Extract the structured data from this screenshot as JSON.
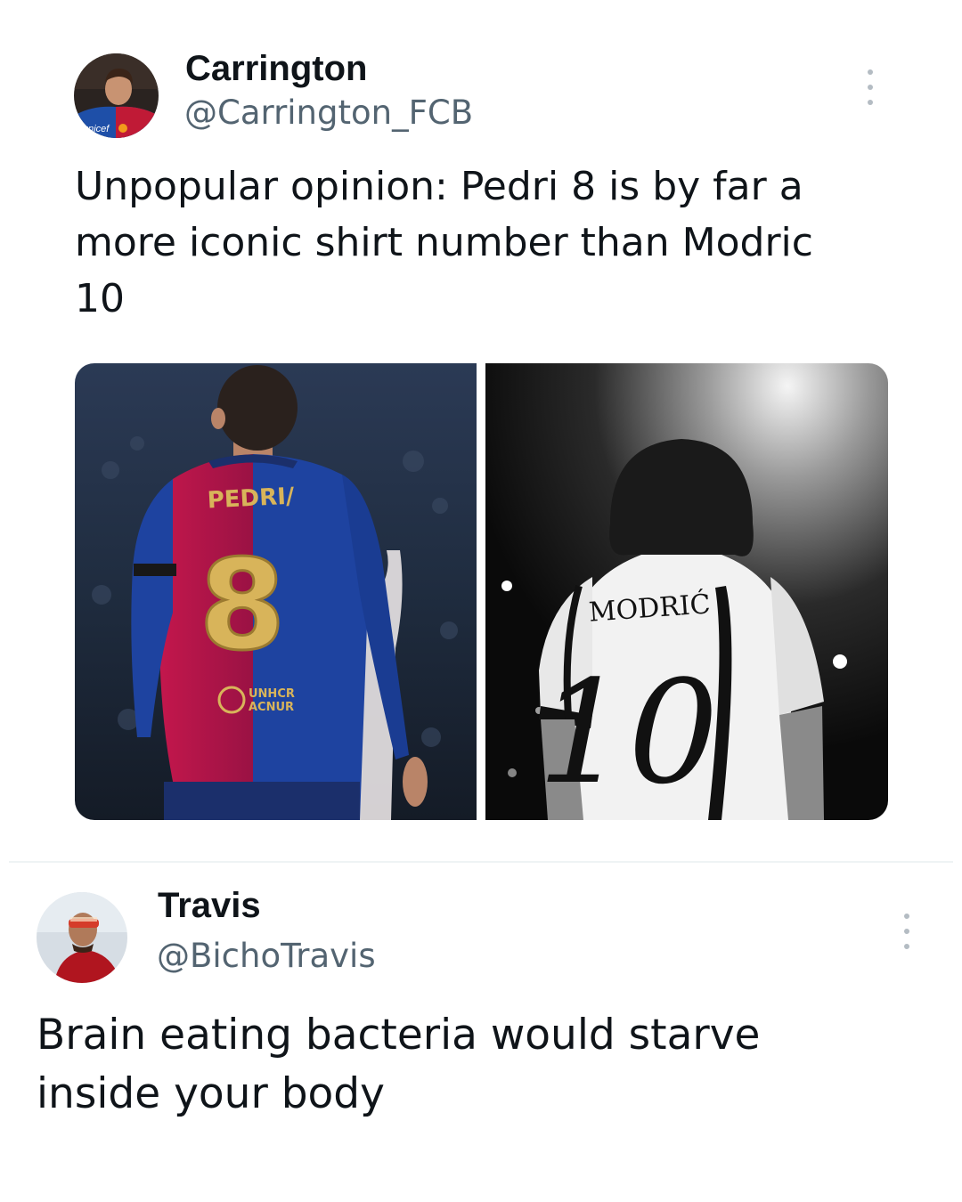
{
  "tweets": [
    {
      "name": "Carrington",
      "handle": "@Carrington_FCB",
      "text_lines": [
        "Unpopular opinion: Pedri 8 is by far a",
        "more iconic shirt number than Modric",
        "10"
      ],
      "media": [
        {
          "shirt_name": "PEDRI",
          "shirt_number": "8",
          "sponsor_line1": "UNHCR",
          "sponsor_line2": "ACNUR"
        },
        {
          "shirt_name": "MODRIĆ",
          "shirt_number": "10"
        }
      ]
    },
    {
      "name": "Travis",
      "handle": "@BichoTravis",
      "text_lines": [
        "Brain eating bacteria would starve",
        "inside your body"
      ]
    }
  ],
  "icons": {
    "more": "more-vertical-icon"
  },
  "colors": {
    "barca_blue": "#1d3f99",
    "barca_red": "#b5154b",
    "gold": "#d8b45a",
    "handle_gray": "#536471"
  }
}
